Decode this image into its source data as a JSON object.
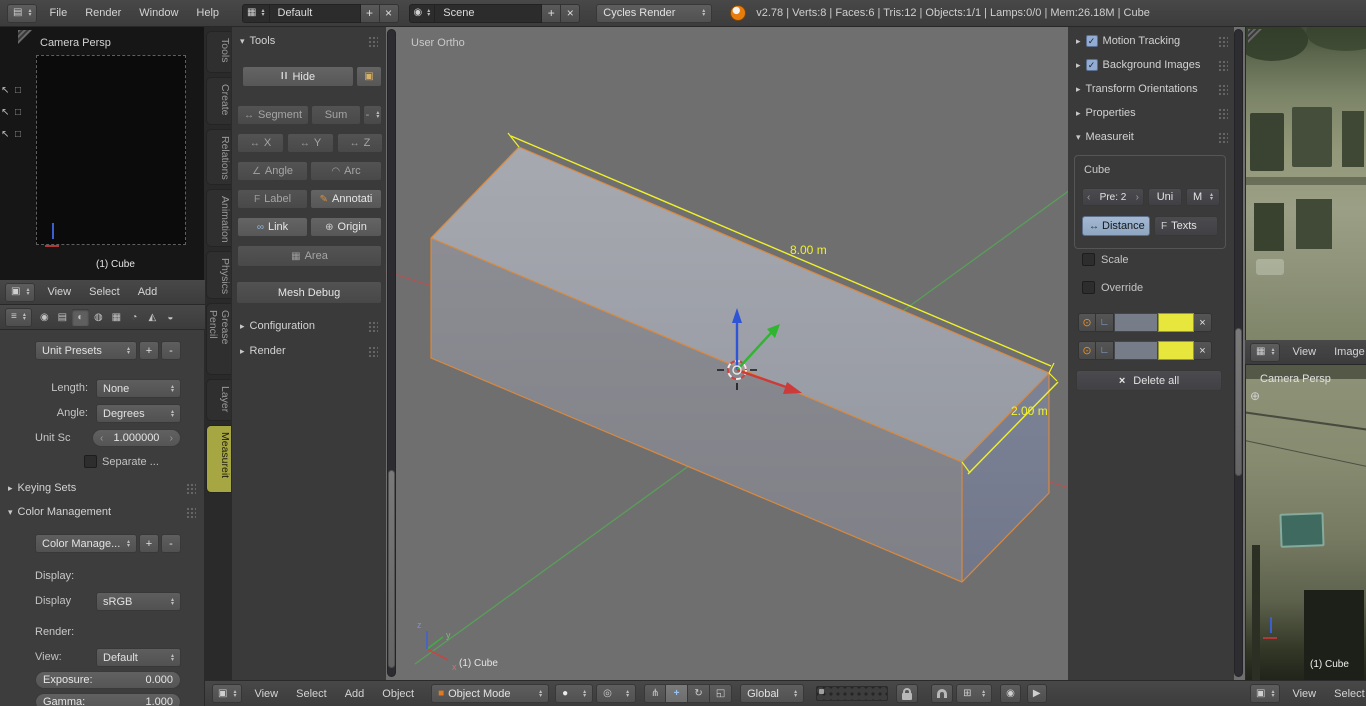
{
  "colors": {
    "accent_orange": "#e87d0d",
    "measure_yellow": "#f1f12b",
    "selected_outline": "#d9893f",
    "viewport_bg": "#6f6f6f",
    "active_tab": "#a6a642",
    "distance_button_bg": "#98aec9",
    "checkbox_checked": "#93acd4"
  },
  "icons": {
    "editor_info": "▤",
    "view3d": "▣",
    "properties_editor": "≡",
    "image_editor": "▦",
    "screen_layout": "▦",
    "scene_icon": "◉",
    "add": "+",
    "close": "×",
    "dd_arrows": "▴\n▾",
    "pause": "II",
    "image": "▣",
    "segment": "↔",
    "angle": "∠",
    "arc": "◠",
    "text_f": "F",
    "annotate": "✎",
    "link": "∞",
    "origin": "⊕",
    "area": "▦",
    "tri_down": "▾",
    "tri_right": "▸",
    "check": "✓",
    "eye": "⊙",
    "style": "∟",
    "stepper_left": "‹",
    "stepper_right": "›",
    "object_cube": "■",
    "shading_sphere": "●",
    "pivot": "◎",
    "manipulator": "⋔",
    "translate": "+",
    "rotate": "↻",
    "scale": "◱",
    "snap_element": "⊞",
    "render_still": "◉",
    "render_anim": "▶",
    "cursor": "↖",
    "box": "□",
    "region_plus": "⊕",
    "sum_dash": "-",
    "render_tab": "◉",
    "render_layers_tab": "▤",
    "scene_tab": "◐",
    "world_tab": "◍",
    "object_tab": "▦",
    "constraints_tab": "◔",
    "data_tab": "◭",
    "material_tab": "◒"
  },
  "topbar": {
    "menus": [
      "File",
      "Render",
      "Window",
      "Help"
    ],
    "layout_value": "Default",
    "scene_value": "Scene",
    "engine_value": "Cycles Render",
    "stats": "v2.78 | Verts:8 | Faces:6 | Tris:12 | Objects:1/1 | Lamps:0/0 | Mem:26.18M | Cube"
  },
  "camera_view": {
    "label": "Camera Persp",
    "object": "(1) Cube",
    "menus": [
      "View",
      "Select",
      "Add"
    ]
  },
  "props": {
    "unit_presets": "Unit Presets",
    "add": "+",
    "remove": "-",
    "length_label": "Length:",
    "length_value": "None",
    "angle_label": "Angle:",
    "angle_value": "Degrees",
    "unit_scale_label": "Unit Sc",
    "unit_scale_value": "1.000000",
    "separate_label": "Separate ...",
    "keying_sets_title": "Keying Sets",
    "color_management_title": "Color Management",
    "color_preset": "Color Manage...",
    "display_heading": "Display:",
    "display_label": "Display",
    "display_value": "sRGB",
    "render_heading": "Render:",
    "view_label": "View:",
    "view_value": "Default",
    "exposure_label": "Exposure:",
    "exposure_value": "0.000",
    "gamma_label": "Gamma:",
    "gamma_value": "1.000"
  },
  "toolshelf": {
    "tabs": [
      "Tools",
      "Create",
      "Relations",
      "Animation",
      "Physics",
      "Grease Pencil",
      "Layer",
      "Measureit"
    ],
    "panel_title": "Tools",
    "hide_label": "Hide",
    "segment_label": "Segment",
    "sum_label": "Sum",
    "sum_value": "-",
    "x_label": "X",
    "y_label": "Y",
    "z_label": "Z",
    "angle_label": "Angle",
    "arc_label": "Arc",
    "label_label": "Label",
    "annotate_label": "Annotati",
    "link_label": "Link",
    "origin_label": "Origin",
    "area_label": "Area",
    "mesh_debug_label": "Mesh Debug",
    "configuration_title": "Configuration",
    "render_title": "Render"
  },
  "viewport": {
    "view_label": "User Ortho",
    "object_label": "(1) Cube",
    "dim_length": "8.00 m",
    "dim_width": "2.00 m",
    "axis_x": "x",
    "axis_y": "y",
    "axis_z": "z"
  },
  "npanel": {
    "motion_tracking": "Motion Tracking",
    "background_images": "Background Images",
    "transform_orientations": "Transform Orientations",
    "properties_title": "Properties",
    "measureit_title": "Measureit",
    "object_name": "Cube",
    "precision_value": "Pre: 2",
    "uni_label": "Uni",
    "unit_value": "M",
    "distance_label": "Distance",
    "texts_label": "Texts",
    "scale_label": "Scale",
    "override_label": "Override",
    "delete_all_label": "Delete all"
  },
  "bottom": {
    "menus": [
      "View",
      "Select",
      "Add",
      "Object"
    ],
    "mode_value": "Object Mode",
    "orientation_value": "Global"
  },
  "image_editor": {
    "menus": [
      "View",
      "Image"
    ]
  },
  "right_view": {
    "label": "Camera Persp",
    "object": "(1) Cube",
    "menus": [
      "View",
      "Select"
    ]
  }
}
